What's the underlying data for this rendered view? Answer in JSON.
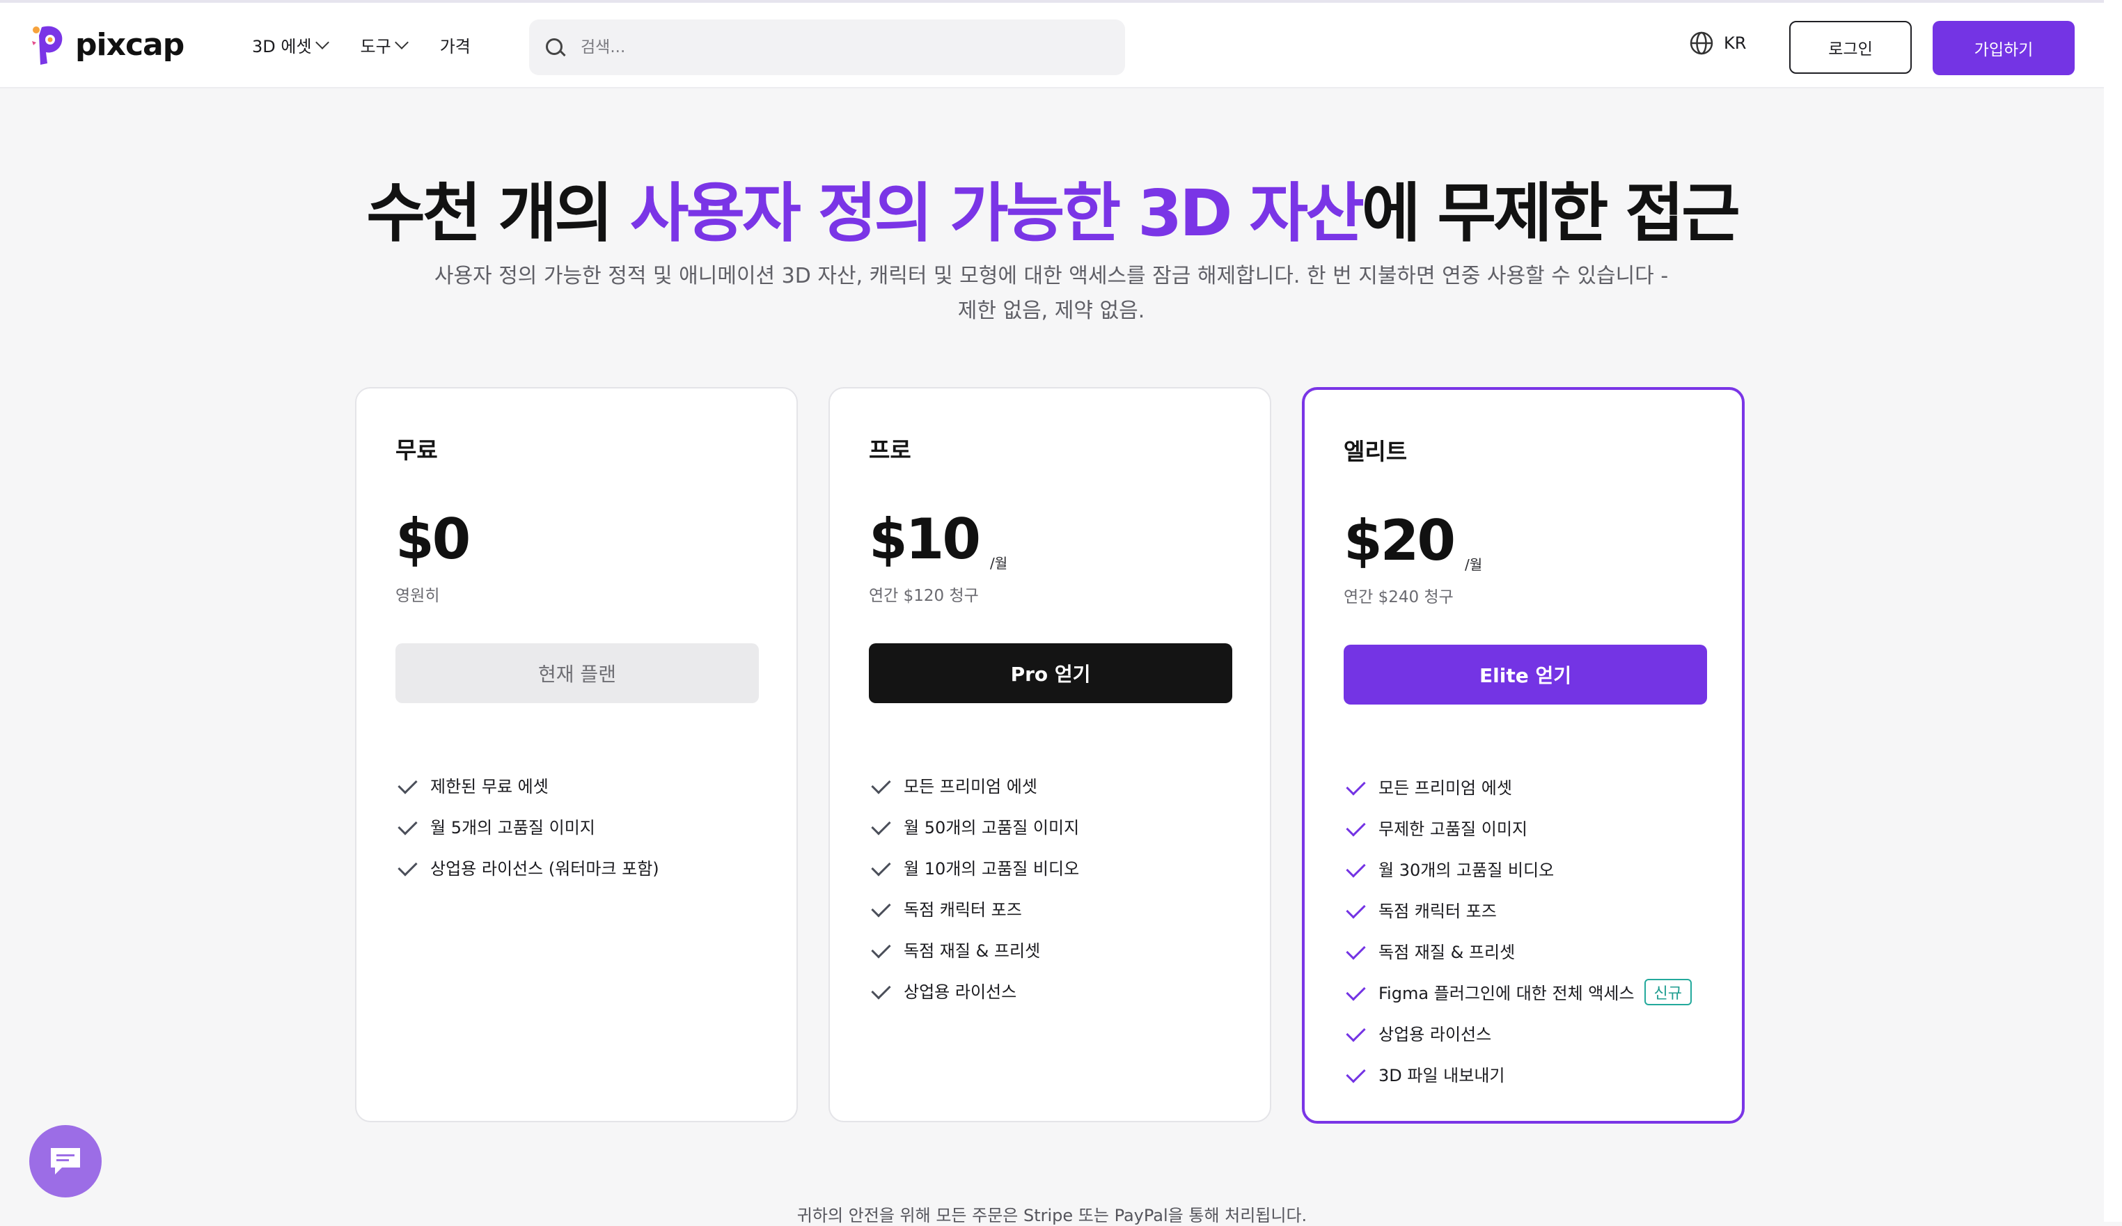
{
  "header": {
    "logo_text": "pixcap",
    "nav": [
      {
        "label": "3D 에셋",
        "has_dropdown": true
      },
      {
        "label": "도구",
        "has_dropdown": true
      },
      {
        "label": "가격",
        "has_dropdown": false
      }
    ],
    "search_placeholder": "검색...",
    "language": "KR",
    "login_label": "로그인",
    "signup_label": "가입하기"
  },
  "hero": {
    "title_part1": "수천 개의 ",
    "title_accent": "사용자 정의 가능한 3D 자산",
    "title_part2": "에 무제한 접근",
    "subtitle_line1": "사용자 정의 가능한 정적 및 애니메이션 3D 자산, 캐릭터 및 모형에 대한 액세스를 잠금 해제합니다. 한 번 지불하면 연중 사용할 수 있습니다 -",
    "subtitle_line2": "제한 없음, 제약 없음."
  },
  "plans": [
    {
      "name": "무료",
      "price": "$0",
      "per": "",
      "billing": "영원히",
      "cta": "현재 플랜",
      "features": [
        "제한된 무료 에셋",
        "월 5개의 고품질 이미지",
        "상업용 라이선스 (워터마크 포함)"
      ]
    },
    {
      "name": "프로",
      "price": "$10",
      "per": "/월",
      "billing": "연간 $120 청구",
      "cta": "Pro 얻기",
      "features": [
        "모든 프리미엄 에셋",
        "월 50개의 고품질 이미지",
        "월 10개의 고품질 비디오",
        "독점 캐릭터 포즈",
        "독점 재질 & 프리셋",
        "상업용 라이선스"
      ]
    },
    {
      "name": "엘리트",
      "price": "$20",
      "per": "/월",
      "billing": "연간 $240 청구",
      "cta": "Elite 얻기",
      "features": [
        "모든 프리미엄 에셋",
        "무제한 고품질 이미지",
        "월 30개의 고품질 비디오",
        "독점 캐릭터 포즈",
        "독점 재질 & 프리셋",
        "Figma 플러그인에 대한 전체 액세스",
        "상업용 라이선스",
        "3D 파일 내보내기"
      ],
      "new_badge": "신규"
    }
  ],
  "footer_note": "귀하의 안전을 위해 모든 주문은 Stripe 또는 PayPal을 통해 처리됩니다.",
  "colors": {
    "accent": "#7434e4",
    "accent_text": "#7a35e6",
    "dark_button": "#141414",
    "badge_teal": "#23a99c"
  },
  "icons": [
    "search-icon",
    "globe-icon",
    "check-icon",
    "chevron-down-icon",
    "chat-icon"
  ]
}
